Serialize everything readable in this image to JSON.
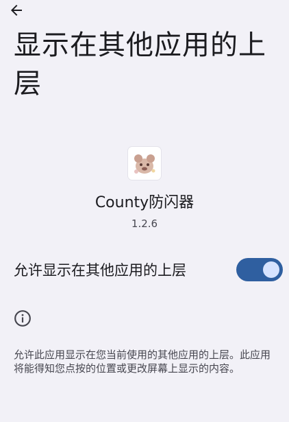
{
  "header": {
    "back_icon": "arrow-left-icon",
    "title": "显示在其他应用的上层"
  },
  "app": {
    "icon": "app-icon",
    "name": "County防闪器",
    "version": "1.2.6"
  },
  "permission": {
    "label": "允许显示在其他应用的上层",
    "enabled": true
  },
  "info": {
    "icon": "info-icon",
    "description": "允许此应用显示在您当前使用的其他应用的上层。此应用将能得知您点按的位置或更改屏幕上显示的内容。"
  },
  "colors": {
    "background": "#f2f1f7",
    "switch_track": "#2f5fa0",
    "switch_thumb": "#d6e3ff"
  }
}
